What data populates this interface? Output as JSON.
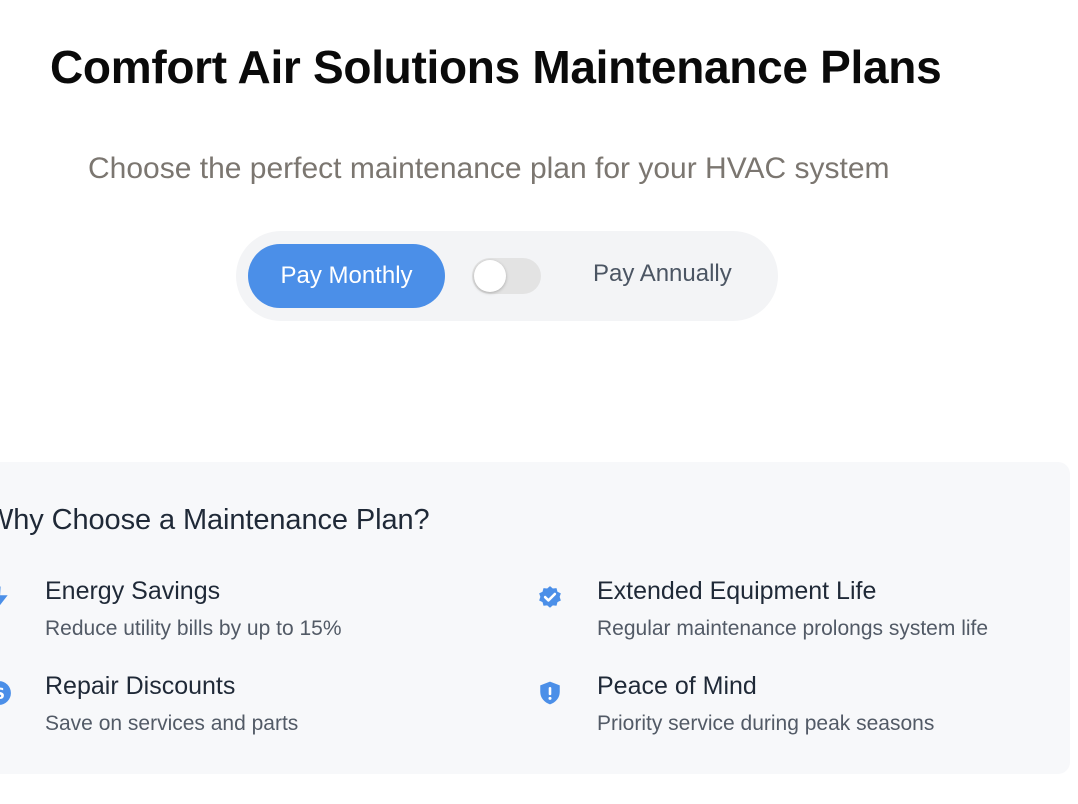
{
  "header": {
    "title": "Comfort Air Solutions Maintenance Plans",
    "subtitle": "Choose the perfect maintenance plan for your HVAC system"
  },
  "billing": {
    "monthly_label": "Pay Monthly",
    "annual_label": "Pay Annually",
    "selected": "monthly",
    "annual_toggle_on": false
  },
  "benefits": {
    "title": "Why Choose a Maintenance Plan?",
    "items": [
      {
        "icon": "lightning-bolt-icon",
        "heading": "Energy Savings",
        "description": "Reduce utility bills by up to 15%"
      },
      {
        "icon": "badge-check-icon",
        "heading": "Extended Equipment Life",
        "description": "Regular maintenance prolongs system life"
      },
      {
        "icon": "dollar-icon",
        "heading": "Repair Discounts",
        "description": "Save on services and parts"
      },
      {
        "icon": "shield-exclamation-icon",
        "heading": "Peace of Mind",
        "description": "Priority service during peak seasons"
      }
    ]
  },
  "colors": {
    "accent": "#4b8fe8",
    "title": "#0a0a0a",
    "subtitle": "#7b7670",
    "panel_bg": "#f7f8fa"
  }
}
